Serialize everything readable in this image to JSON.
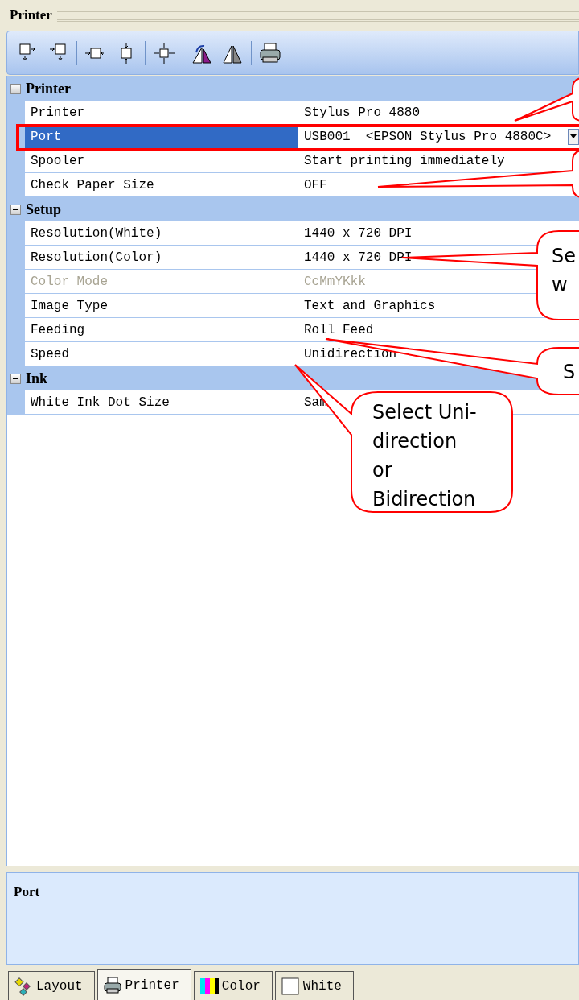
{
  "panel_title": "Printer",
  "groups": [
    {
      "title": "Printer",
      "expanded": true,
      "properties": [
        {
          "name": "Printer",
          "value": "Stylus Pro 4880",
          "selected": false,
          "disabled": false,
          "kind": "text"
        },
        {
          "name": "Port",
          "value": "USB001  <EPSON Stylus Pro 4880C>",
          "selected": true,
          "disabled": false,
          "kind": "dropdown"
        },
        {
          "name": "Spooler",
          "value": "Start printing immediately",
          "selected": false,
          "disabled": false,
          "kind": "text"
        },
        {
          "name": "Check Paper Size",
          "value": "OFF",
          "selected": false,
          "disabled": false,
          "kind": "text"
        }
      ]
    },
    {
      "title": "Setup",
      "expanded": true,
      "properties": [
        {
          "name": "Resolution(White)",
          "value": "1440 x 720 DPI",
          "selected": false,
          "disabled": false,
          "kind": "text"
        },
        {
          "name": "Resolution(Color)",
          "value": "1440 x 720 DPI",
          "selected": false,
          "disabled": false,
          "kind": "text"
        },
        {
          "name": "Color Mode",
          "value": "CcMmYKkk",
          "selected": false,
          "disabled": true,
          "kind": "text"
        },
        {
          "name": "Image Type",
          "value": "Text and Graphics",
          "selected": false,
          "disabled": false,
          "kind": "text"
        },
        {
          "name": "Feeding",
          "value": "Roll Feed",
          "selected": false,
          "disabled": false,
          "kind": "text"
        },
        {
          "name": "Speed",
          "value": "Unidirection",
          "selected": false,
          "disabled": false,
          "kind": "text"
        }
      ]
    },
    {
      "title": "Ink",
      "expanded": true,
      "properties": [
        {
          "name": "White Ink Dot Size",
          "value": "Sam",
          "selected": false,
          "disabled": false,
          "kind": "text"
        }
      ]
    }
  ],
  "description": {
    "title": "Port"
  },
  "tabs": [
    {
      "label": "Layout",
      "selected": false
    },
    {
      "label": "Printer",
      "selected": true
    },
    {
      "label": "Color",
      "selected": false
    },
    {
      "label": "White",
      "selected": false
    }
  ],
  "callouts": [
    {
      "lines": [
        "Se",
        "w"
      ]
    },
    {
      "lines": [
        "S"
      ]
    },
    {
      "lines": [
        "Select Uni-",
        "direction",
        "or",
        "Bidirection"
      ]
    }
  ]
}
